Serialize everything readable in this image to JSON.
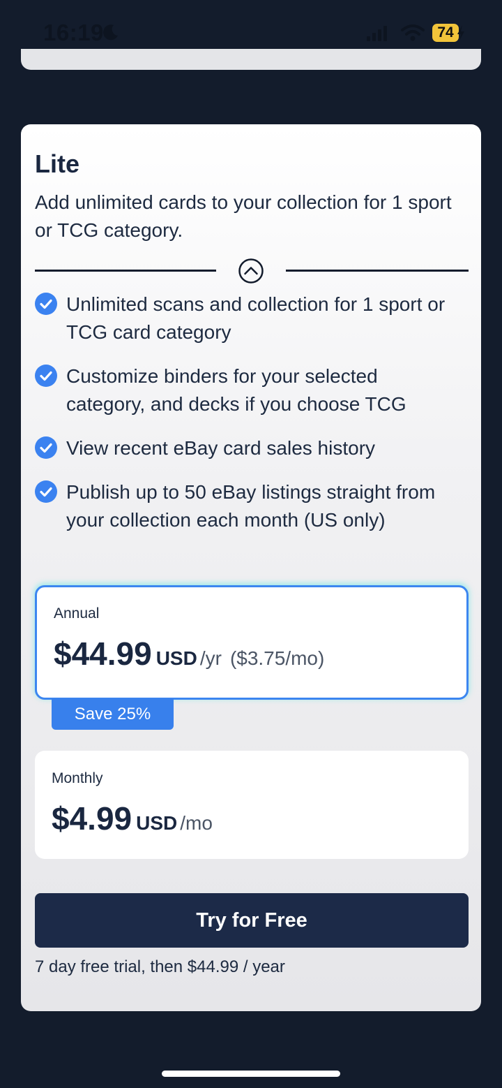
{
  "status_bar": {
    "time": "16:19",
    "battery": "74",
    "icons": [
      "moon-icon",
      "cellular-signal-icon",
      "wifi-icon",
      "battery-charging-icon"
    ]
  },
  "plan": {
    "title": "Lite",
    "description": "Add unlimited cards to your collection for 1 sport or TCG category.",
    "features": [
      "Unlimited scans and collection for 1 sport or TCG card category",
      "Customize binders for your selected category, and decks if you choose TCG",
      "View recent eBay card sales history",
      "Publish up to 50 eBay listings straight from your collection each month (US only)"
    ],
    "options": {
      "annual": {
        "label": "Annual",
        "price": "$44.99",
        "currency": "USD",
        "period": "/yr",
        "monthly_equivalent": "($3.75/mo)",
        "badge": "Save 25%",
        "selected": true
      },
      "monthly": {
        "label": "Monthly",
        "price": "$4.99",
        "currency": "USD",
        "period": "/mo",
        "selected": false
      }
    },
    "cta_label": "Try for Free",
    "trial_note": "7 day free trial, then $44.99 / year"
  },
  "colors": {
    "background": "#131c2c",
    "check": "#3b82f0",
    "selected_border": "#3c86f0",
    "badge": "#3880ec",
    "button": "#1c2a48",
    "battery": "#f2c43a"
  }
}
